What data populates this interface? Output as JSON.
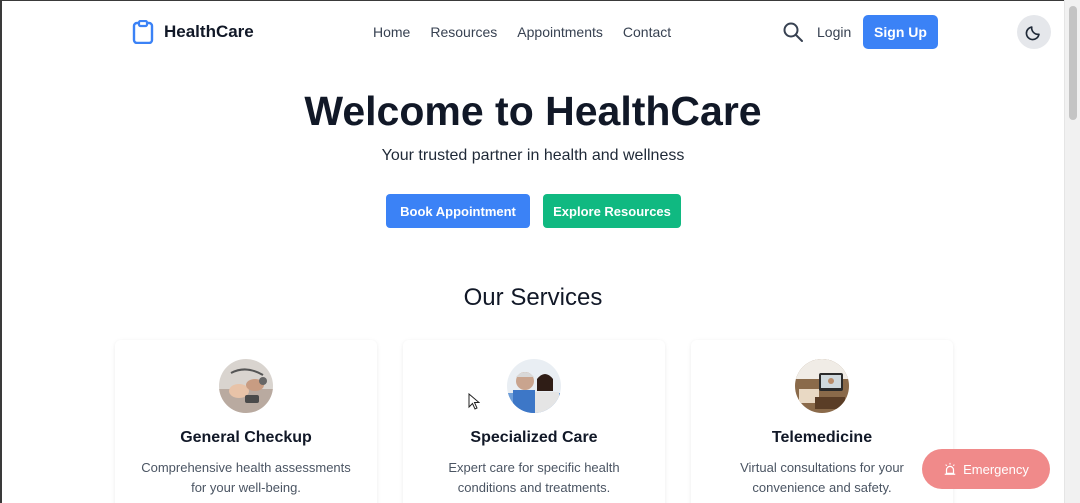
{
  "navbar": {
    "brand": "HealthCare",
    "links": [
      "Home",
      "Resources",
      "Appointments",
      "Contact"
    ],
    "login": "Login",
    "signup": "Sign Up",
    "icons": {
      "logo": "clipboard-icon",
      "search": "search-icon",
      "theme": "moon-icon"
    }
  },
  "hero": {
    "title": "Welcome to HealthCare",
    "subtitle": "Your trusted partner in health and wellness",
    "primary_button": "Book Appointment",
    "secondary_button": "Explore Resources"
  },
  "services": {
    "title": "Our Services",
    "cards": [
      {
        "title": "General Checkup",
        "desc": "Comprehensive health assessments for your well-being."
      },
      {
        "title": "Specialized Care",
        "desc": "Expert care for specific health conditions and treatments."
      },
      {
        "title": "Telemedicine",
        "desc": "Virtual consultations for your convenience and safety."
      }
    ]
  },
  "emergency": {
    "label": "Emergency"
  },
  "colors": {
    "primary": "#3b82f6",
    "secondary": "#10b981",
    "emergency": "#f08a8a",
    "text": "#111827"
  }
}
